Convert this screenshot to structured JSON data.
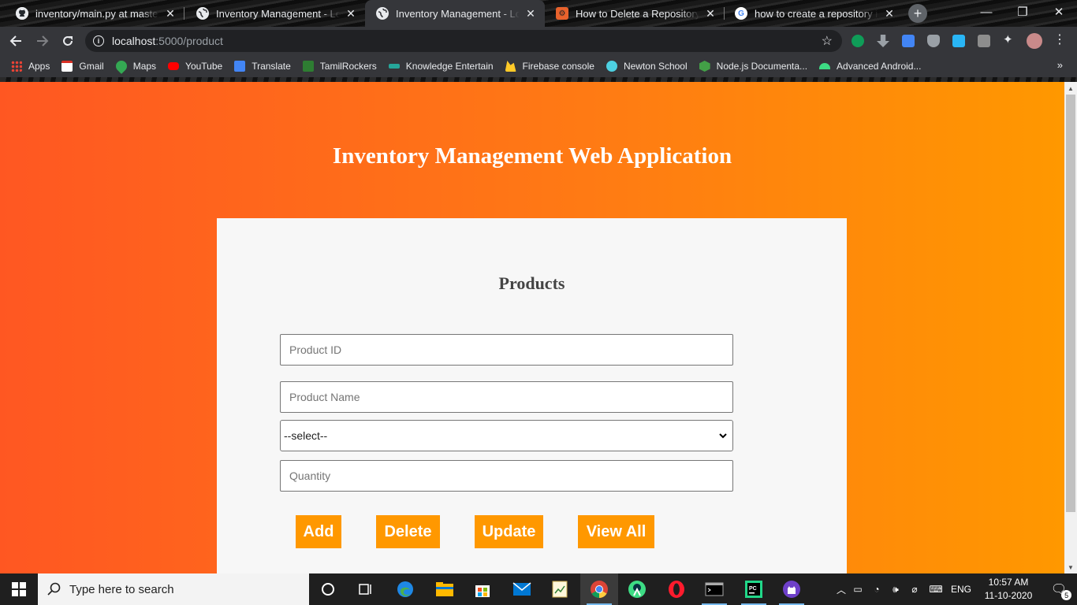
{
  "browser": {
    "tabs": [
      {
        "title": "inventory/main.py at master · I",
        "favicon": "github-icon",
        "active": false
      },
      {
        "title": "Inventory Management - Login",
        "favicon": "globe-icon",
        "active": false
      },
      {
        "title": "Inventory Management - Login",
        "favicon": "globe-icon",
        "active": true
      },
      {
        "title": "How to Delete a Repository in G",
        "favicon": "dev-icon",
        "active": false
      },
      {
        "title": "how to create a repository in gi",
        "favicon": "google-icon",
        "active": false
      }
    ],
    "address": {
      "host": "localhost",
      "path": ":5000/product"
    },
    "bookmarks": [
      {
        "label": "Apps",
        "icon": "apps-grid-icon",
        "color": "#ea4335"
      },
      {
        "label": "Gmail",
        "icon": "gmail-icon",
        "color": "#d93025"
      },
      {
        "label": "Maps",
        "icon": "maps-icon",
        "color": "#34a853"
      },
      {
        "label": "YouTube",
        "icon": "youtube-icon",
        "color": "#ff0000"
      },
      {
        "label": "Translate",
        "icon": "translate-icon",
        "color": "#4285f4"
      },
      {
        "label": "TamilRockers",
        "icon": "tamilrockers-icon",
        "color": "#2e7d32"
      },
      {
        "label": "Knowledge Entertain",
        "icon": "knowledge-icon",
        "color": "#26a69a"
      },
      {
        "label": "Firebase console",
        "icon": "firebase-icon",
        "color": "#ffca28"
      },
      {
        "label": "Newton School",
        "icon": "newton-icon",
        "color": "#4dd0e1"
      },
      {
        "label": "Node.js Documenta...",
        "icon": "nodejs-icon",
        "color": "#43a047"
      },
      {
        "label": "Advanced Android...",
        "icon": "android-icon",
        "color": "#3ddc84"
      }
    ]
  },
  "page": {
    "app_title": "Inventory Management Web Application",
    "card_title": "Products",
    "fields": {
      "product_id_placeholder": "Product ID",
      "product_name_placeholder": "Product Name",
      "select_value": "--select--",
      "quantity_placeholder": "Quantity"
    },
    "buttons": {
      "add": "Add",
      "delete": "Delete",
      "update": "Update",
      "view_all": "View All"
    },
    "colors": {
      "gradient_start": "#ff5722",
      "gradient_end": "#ff9800",
      "button": "#ff9800",
      "card": "#f7f7f7"
    }
  },
  "taskbar": {
    "search_placeholder": "Type here to search",
    "language": "ENG",
    "time": "10:57 AM",
    "date": "11-10-2020",
    "notifications": "5"
  }
}
